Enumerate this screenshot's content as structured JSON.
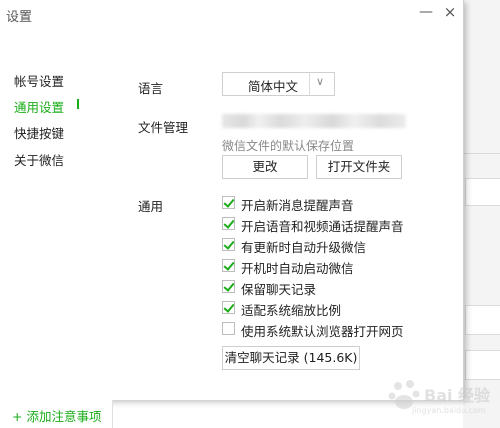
{
  "window": {
    "title": "设置",
    "minimize_glyph": "—",
    "close_glyph": "×"
  },
  "sidebar": {
    "items": [
      {
        "label": "帐号设置",
        "active": false
      },
      {
        "label": "通用设置",
        "active": true
      },
      {
        "label": "快捷按键",
        "active": false
      },
      {
        "label": "关于微信",
        "active": false
      }
    ]
  },
  "language": {
    "label": "语言",
    "value": "简体中文"
  },
  "file_management": {
    "label": "文件管理",
    "hint": "微信文件的默认保存位置",
    "change_button": "更改",
    "open_folder_button": "打开文件夹"
  },
  "general": {
    "label": "通用",
    "options": [
      {
        "label": "开启新消息提醒声音",
        "checked": true
      },
      {
        "label": "开启语音和视频通话提醒声音",
        "checked": true
      },
      {
        "label": "有更新时自动升级微信",
        "checked": true
      },
      {
        "label": "开机时自动启动微信",
        "checked": true
      },
      {
        "label": "保留聊天记录",
        "checked": true
      },
      {
        "label": "适配系统缩放比例",
        "checked": true
      },
      {
        "label": "使用系统默认浏览器打开网页",
        "checked": false
      }
    ],
    "clear_history_button": "清空聊天记录 (145.6K)"
  },
  "bottom_bar": {
    "add_note": "+ 添加注意事项"
  },
  "colors": {
    "accent": "#1aad19",
    "border": "#cfcfcf"
  },
  "watermark": {
    "text": "Bai 经验",
    "sub": "jingyan.baidu.com"
  }
}
